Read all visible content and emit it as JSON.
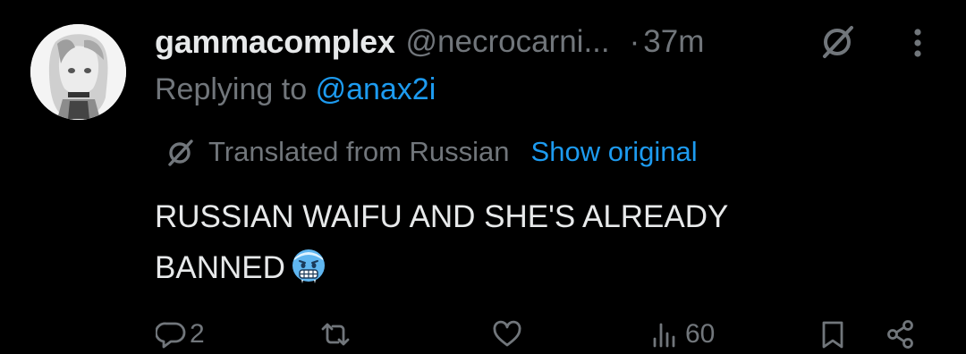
{
  "tweet": {
    "display_name": "gammacomplex",
    "handle": "@necrocarni...",
    "separator": "·",
    "time": "37m",
    "reply_prefix": "Replying to",
    "reply_to": "@anax2i",
    "translation": {
      "label": "Translated from Russian",
      "show_original": "Show original"
    },
    "body_line1": "RUSSIAN WAIFU AND SHE'S ALREADY",
    "body_line2": "BANNED",
    "emoji": "cold-face-emoji"
  },
  "actions": {
    "replies": "2",
    "retweets": "",
    "likes": "",
    "views": "60"
  },
  "colors": {
    "background": "#000000",
    "text": "#e7e9ea",
    "secondary": "#71767b",
    "link": "#1d9bf0"
  }
}
